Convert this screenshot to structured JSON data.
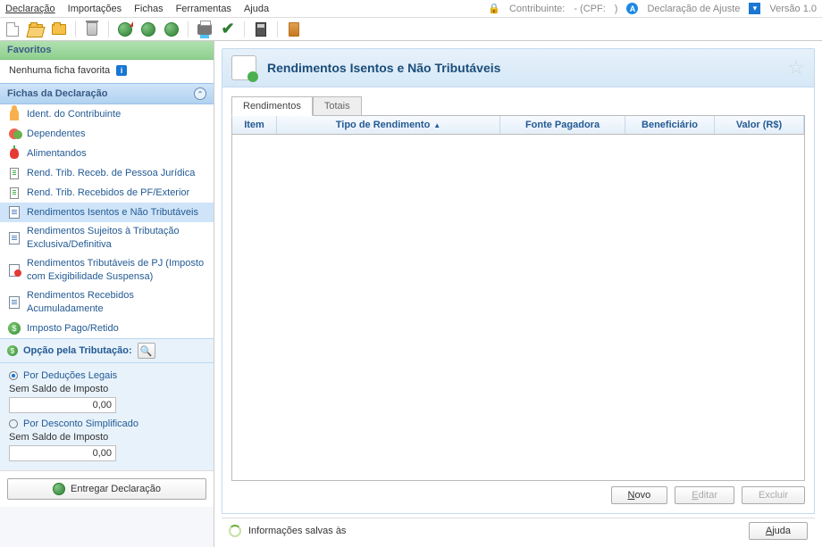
{
  "menu": {
    "declaracao": "Declaração",
    "importacoes": "Importações",
    "fichas": "Fichas",
    "ferramentas": "Ferramentas",
    "ajuda": "Ajuda"
  },
  "header_right": {
    "contribuinte": "Contribuinte:",
    "cpf": "- (CPF:",
    "cpf_close": ")",
    "declaracao_tipo": "Declaração de Ajuste",
    "versao": "Versão 1.0"
  },
  "sidebar": {
    "favoritos_title": "Favoritos",
    "fav_empty": "Nenhuma ficha favorita",
    "fichas_title": "Fichas da Declaração",
    "items": [
      {
        "label": "Ident. do Contribuinte"
      },
      {
        "label": "Dependentes"
      },
      {
        "label": "Alimentandos"
      },
      {
        "label": "Rend. Trib. Receb. de Pessoa Jurídica"
      },
      {
        "label": "Rend. Trib. Recebidos de PF/Exterior"
      },
      {
        "label": "Rendimentos Isentos e Não Tributáveis"
      },
      {
        "label": "Rendimentos Sujeitos à Tributação Exclusiva/Definitiva"
      },
      {
        "label": "Rendimentos Tributáveis de PJ (Imposto com Exigibilidade Suspensa)"
      },
      {
        "label": "Rendimentos Recebidos Acumuladamente"
      },
      {
        "label": "Imposto Pago/Retido"
      }
    ],
    "opcao_title": "Opção pela Tributação:",
    "opt1": "Por Deduções Legais",
    "opt1_sub": "Sem Saldo de Imposto",
    "opt1_val": "0,00",
    "opt2": "Por Desconto Simplificado",
    "opt2_sub": "Sem Saldo de Imposto",
    "opt2_val": "0,00",
    "entregar": "Entregar Declaração"
  },
  "main": {
    "title": "Rendimentos Isentos e Não Tributáveis",
    "tabs": {
      "rend": "Rendimentos",
      "totais": "Totais"
    },
    "columns": {
      "item": "Item",
      "tipo": "Tipo de Rendimento",
      "fonte": "Fonte Pagadora",
      "bene": "Beneficiário",
      "valor": "Valor (R$)"
    },
    "actions": {
      "novo": "Novo",
      "editar": "Editar",
      "excluir": "Excluir"
    },
    "status": "Informações salvas às",
    "ajuda": "Ajuda"
  }
}
